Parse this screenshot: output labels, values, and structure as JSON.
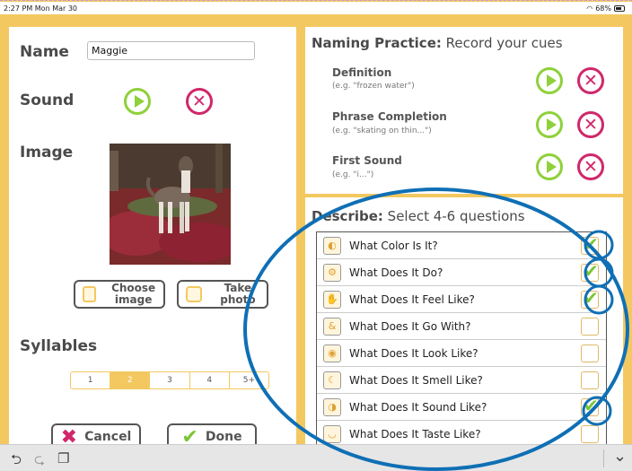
{
  "status": {
    "time": "2:27 PM  Mon Mar 30",
    "battery": "68%"
  },
  "left": {
    "name_label": "Name",
    "name_value": "Maggie",
    "sound_label": "Sound",
    "image_label": "Image",
    "choose_image": "Choose image",
    "take_photo": "Take photo",
    "syllables_label": "Syllables",
    "syllables": [
      "1",
      "2",
      "3",
      "4",
      "5+"
    ],
    "selected_syllable": "2",
    "cancel": "Cancel",
    "done": "Done"
  },
  "naming": {
    "title_bold": "Naming Practice:",
    "title_rest": " Record your cues",
    "cues": [
      {
        "title": "Definition",
        "example": "(e.g. \"frozen water\")"
      },
      {
        "title": "Phrase Completion",
        "example": "(e.g. \"skating on thin...\")"
      },
      {
        "title": "First Sound",
        "example": "(e.g. \"i...\")"
      }
    ]
  },
  "describe": {
    "title_bold": "Describe:",
    "title_rest": " Select 4-6 questions",
    "questions": [
      {
        "text": "What Color Is It?",
        "checked": true
      },
      {
        "text": "What Does It Do?",
        "checked": true
      },
      {
        "text": "What Does It Feel Like?",
        "checked": true
      },
      {
        "text": "What Does It Go With?",
        "checked": false
      },
      {
        "text": "What Does It Look Like?",
        "checked": false
      },
      {
        "text": "What Does It Smell Like?",
        "checked": false
      },
      {
        "text": "What Does It Sound Like?",
        "checked": true
      },
      {
        "text": "What Does It Taste Like?",
        "checked": false
      }
    ]
  },
  "toolbar": {
    "undo": "⮌",
    "redo": "⮎",
    "paste": "❐",
    "collapse": "⌄"
  },
  "colors": {
    "accent": "#f3c860",
    "play": "#8ed13a",
    "delete": "#d0276a",
    "annotation": "#0f6fb5"
  }
}
